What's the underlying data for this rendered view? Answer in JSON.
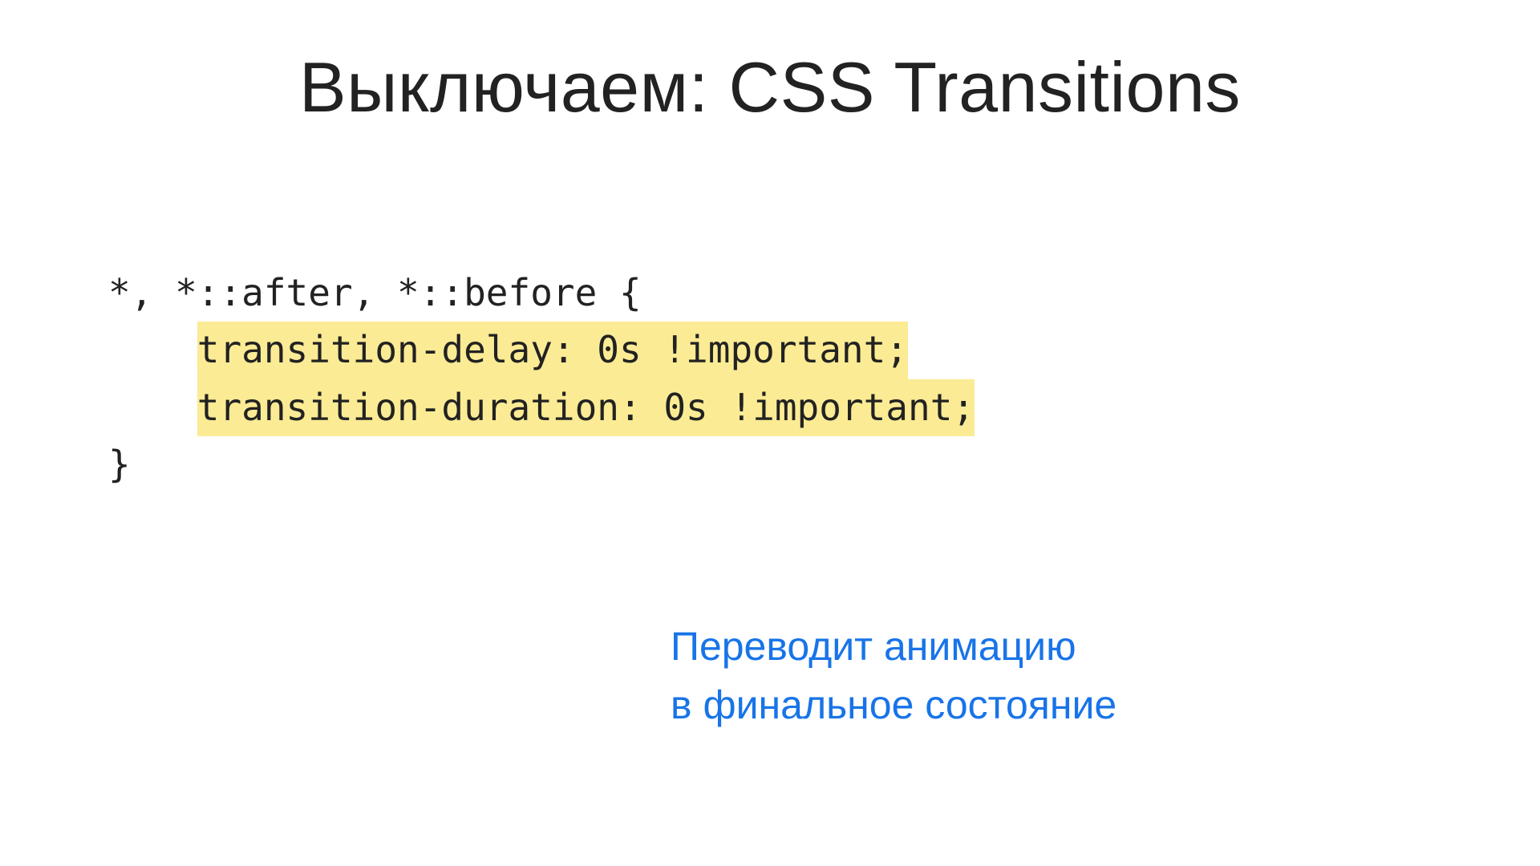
{
  "title": "Выключаем: CSS Transitions",
  "code": {
    "line1": "*, *::after, *::before {",
    "indent": "    ",
    "hl1": "transition-delay: 0s !important;",
    "hl2": "transition-duration: 0s !important;",
    "line4": "}"
  },
  "caption": {
    "line1": "Переводит анимацию",
    "line2": "в финальное состояние"
  }
}
